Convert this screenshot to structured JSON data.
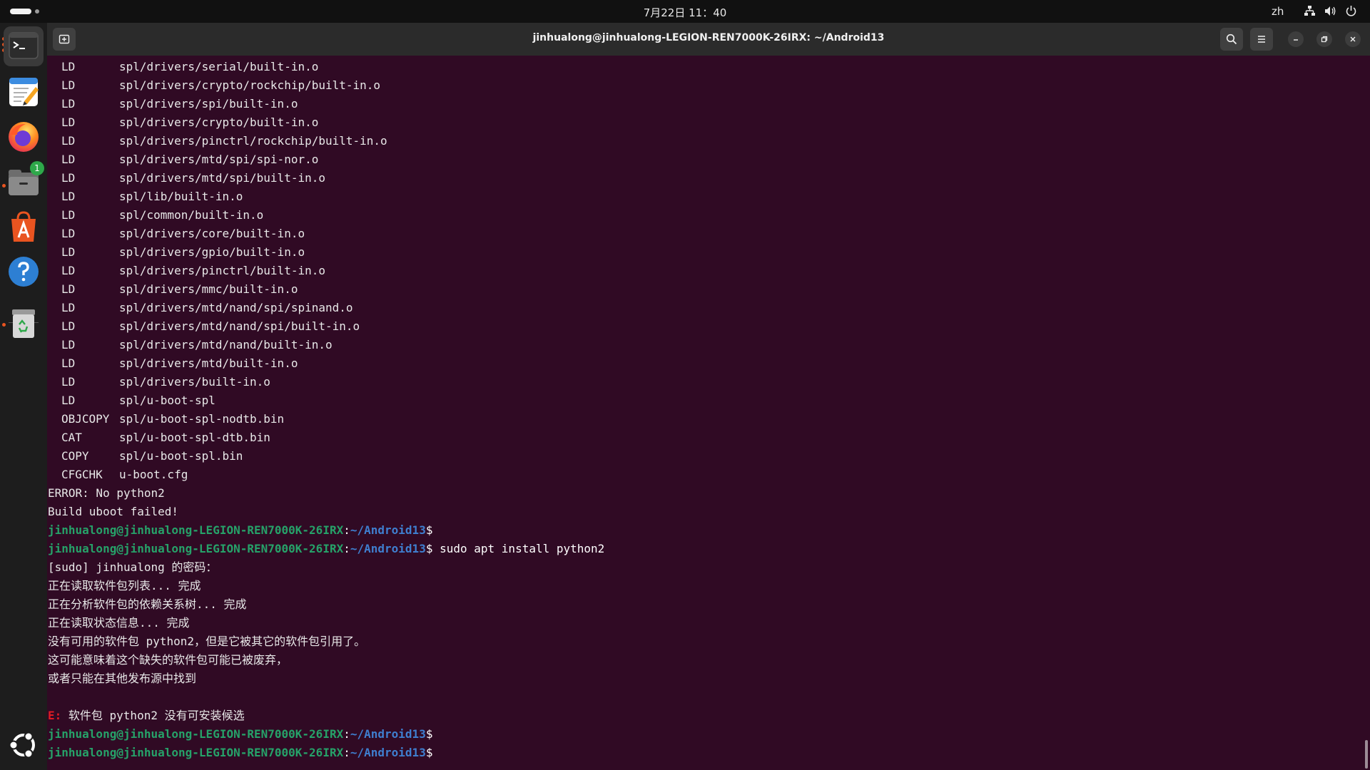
{
  "topbar": {
    "clock": "7月22日 11：40",
    "input_method": "zh"
  },
  "dock": {
    "apps": [
      {
        "name": "Terminal",
        "icon": "terminal-icon"
      },
      {
        "name": "Text Editor",
        "icon": "text-editor-icon"
      },
      {
        "name": "Firefox",
        "icon": "firefox-icon"
      },
      {
        "name": "Files",
        "icon": "files-icon",
        "badge": "1"
      },
      {
        "name": "App Center",
        "icon": "app-center-icon"
      },
      {
        "name": "Help",
        "icon": "help-icon"
      },
      {
        "name": "Trash",
        "icon": "trash-icon"
      }
    ],
    "show_apps_icon": "ubuntu-logo-icon"
  },
  "window": {
    "title": "jinhualong@jinhualong-LEGION-REN7000K-26IRX: ~/Android13"
  },
  "terminal": {
    "build_lines": [
      {
        "tag": "LD",
        "path": "spl/drivers/serial/built-in.o"
      },
      {
        "tag": "LD",
        "path": "spl/drivers/crypto/rockchip/built-in.o"
      },
      {
        "tag": "LD",
        "path": "spl/drivers/spi/built-in.o"
      },
      {
        "tag": "LD",
        "path": "spl/drivers/crypto/built-in.o"
      },
      {
        "tag": "LD",
        "path": "spl/drivers/pinctrl/rockchip/built-in.o"
      },
      {
        "tag": "LD",
        "path": "spl/drivers/mtd/spi/spi-nor.o"
      },
      {
        "tag": "LD",
        "path": "spl/drivers/mtd/spi/built-in.o"
      },
      {
        "tag": "LD",
        "path": "spl/lib/built-in.o"
      },
      {
        "tag": "LD",
        "path": "spl/common/built-in.o"
      },
      {
        "tag": "LD",
        "path": "spl/drivers/core/built-in.o"
      },
      {
        "tag": "LD",
        "path": "spl/drivers/gpio/built-in.o"
      },
      {
        "tag": "LD",
        "path": "spl/drivers/pinctrl/built-in.o"
      },
      {
        "tag": "LD",
        "path": "spl/drivers/mmc/built-in.o"
      },
      {
        "tag": "LD",
        "path": "spl/drivers/mtd/nand/spi/spinand.o"
      },
      {
        "tag": "LD",
        "path": "spl/drivers/mtd/nand/spi/built-in.o"
      },
      {
        "tag": "LD",
        "path": "spl/drivers/mtd/nand/built-in.o"
      },
      {
        "tag": "LD",
        "path": "spl/drivers/mtd/built-in.o"
      },
      {
        "tag": "LD",
        "path": "spl/drivers/built-in.o"
      },
      {
        "tag": "LD",
        "path": "spl/u-boot-spl"
      },
      {
        "tag": "OBJCOPY",
        "path": "spl/u-boot-spl-nodtb.bin"
      },
      {
        "tag": "CAT",
        "path": "spl/u-boot-spl-dtb.bin"
      },
      {
        "tag": "COPY",
        "path": "spl/u-boot-spl.bin"
      },
      {
        "tag": "CFGCHK",
        "path": "u-boot.cfg"
      }
    ],
    "error_line": "ERROR: No python2",
    "failed_line": "Build uboot failed!",
    "prompt_host": "jinhualong@jinhualong-LEGION-REN7000K-26IRX",
    "prompt_sep": ":",
    "prompt_path": "~/Android13",
    "prompt_dollar": "$",
    "command": " sudo apt install python2",
    "apt_output": [
      "[sudo] jinhualong 的密码：",
      "正在读取软件包列表... 完成",
      "正在分析软件包的依赖关系树... 完成",
      "正在读取状态信息... 完成",
      "没有可用的软件包 python2，但是它被其它的软件包引用了。",
      "这可能意味着这个缺失的软件包可能已被废弃，",
      "或者只能在其他发布源中找到",
      ""
    ],
    "apt_error_label": "E:",
    "apt_error_text": " 软件包 python2 没有可安装候选"
  },
  "colors": {
    "terminal_bg": "#300a24",
    "prompt_host": "#26a269",
    "prompt_path": "#3f7fd0",
    "error": "#e01b24"
  }
}
